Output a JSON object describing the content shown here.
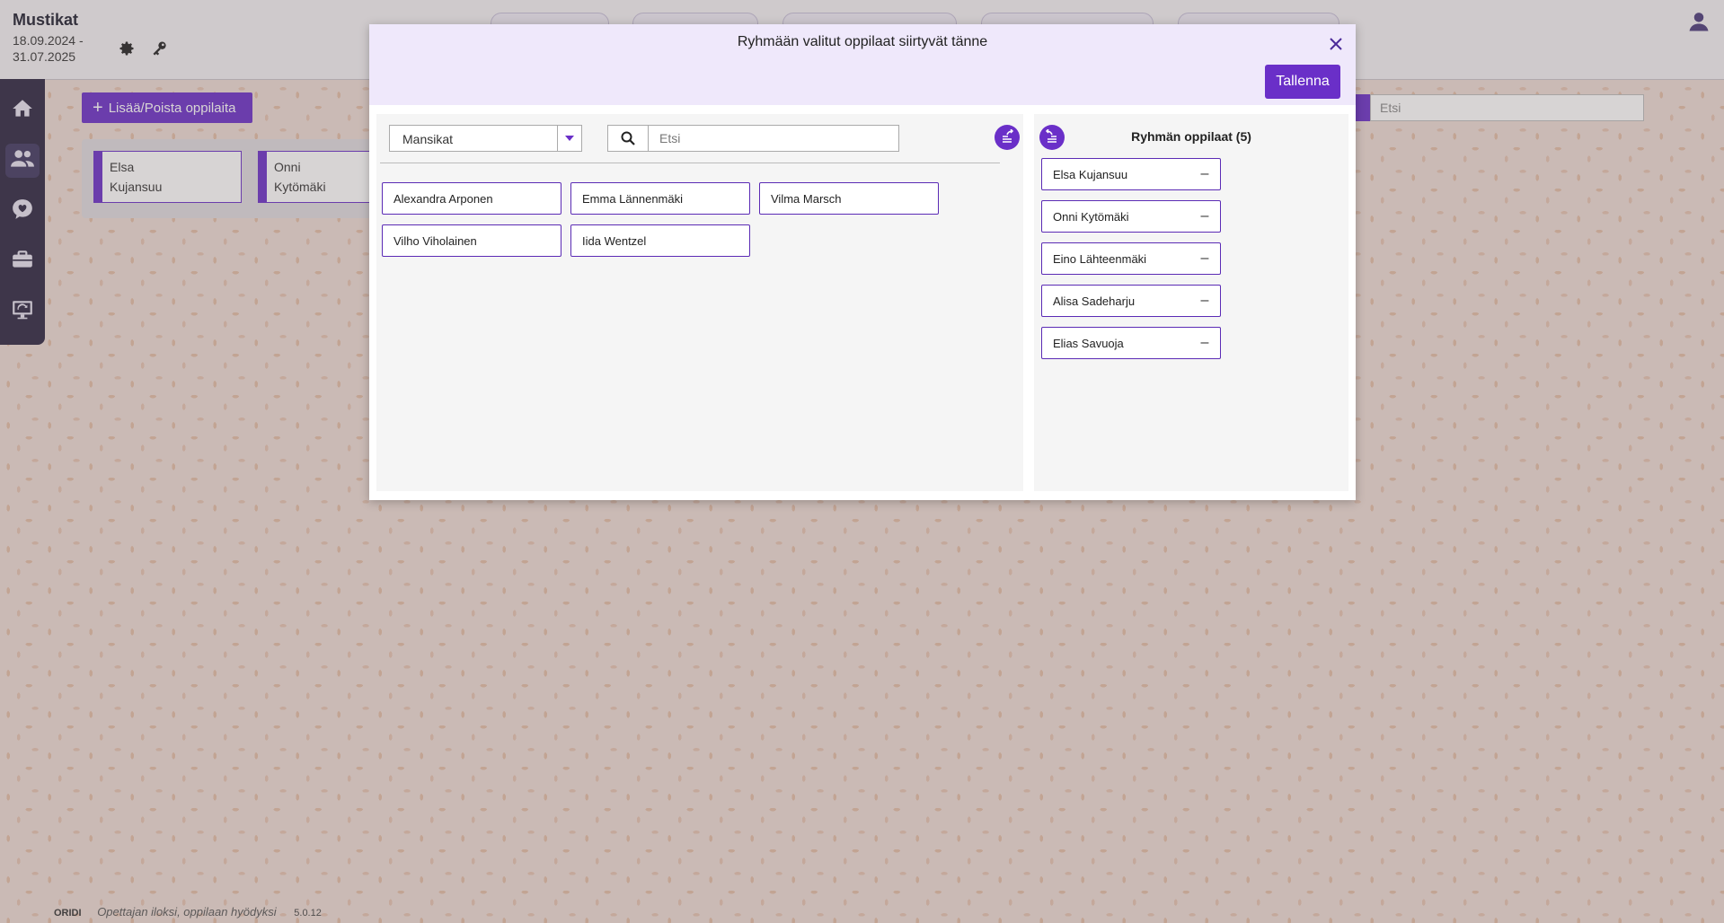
{
  "app": {
    "title": "Mustikat",
    "dates": "18.09.2024 - 31.07.2025"
  },
  "background": {
    "add_button_label": "Lisää/Poista oppilaita",
    "cards": [
      {
        "first": "Elsa",
        "last": "Kujansuu"
      },
      {
        "first": "Onni",
        "last": "Kytömäki"
      }
    ],
    "search_placeholder": "Etsi"
  },
  "modal": {
    "title": "Ryhmään valitut oppilaat siirtyvät tänne",
    "save_label": "Tallenna",
    "left": {
      "group_select_value": "Mansikat",
      "search_placeholder": "Etsi",
      "students": [
        "Alexandra Arponen",
        "Emma Lännenmäki",
        "Vilma Marsch",
        "Vilho Viholainen",
        "Iida Wentzel"
      ]
    },
    "right": {
      "title": "Ryhmän oppilaat (5)",
      "members": [
        "Elsa Kujansuu",
        "Onni Kytömäki",
        "Eino Lähteenmäki",
        "Alisa Sadeharju",
        "Elias Savuoja"
      ]
    }
  },
  "footer": {
    "logo": "ORIDI",
    "slogan": "Opettajan iloksi, oppilaan hyödyksi",
    "version": "5.0.12"
  },
  "colors": {
    "accent": "#6a2fc8",
    "nav": "#2b2540",
    "header_bg": "#efe8fb"
  },
  "icons": [
    "gear-icon",
    "key-icon",
    "user-icon",
    "home-icon",
    "users-icon",
    "heart-chat-icon",
    "briefcase-icon",
    "presentation-icon",
    "close-icon",
    "search-icon",
    "chevron-down-icon",
    "move-all-icon",
    "move-back-icon",
    "minus-icon",
    "plus-icon"
  ]
}
